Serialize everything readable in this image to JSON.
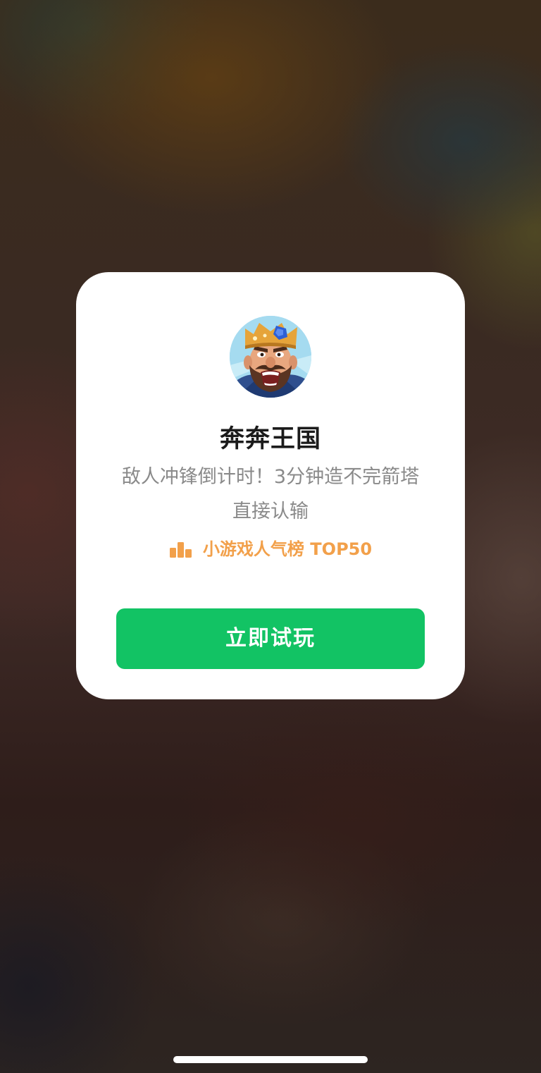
{
  "game": {
    "icon": "king-avatar-icon",
    "title": "奔奔王国",
    "description": "敌人冲锋倒计时！3分钟造不完箭塔直接认输",
    "rank_icon": "bar-chart-icon",
    "rank_label": "小游戏人气榜 TOP50"
  },
  "actions": {
    "play_label": "立即试玩"
  },
  "colors": {
    "accent_green": "#12c364",
    "rank_orange": "#f2a04a",
    "title_text": "#1b1b1b",
    "desc_text": "#8a8a8a"
  }
}
